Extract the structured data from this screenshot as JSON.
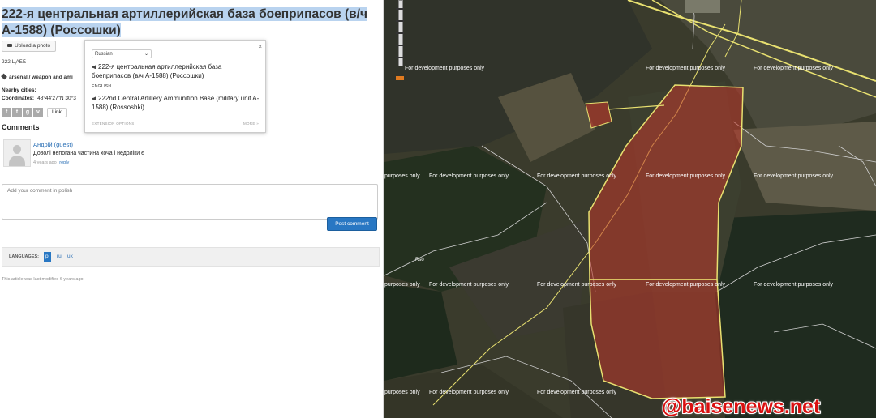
{
  "article": {
    "title": "222-я центральная артиллерийская база боеприпасов (в/ч А-1588) (Россошки)",
    "upload_label": "Upload a photo",
    "abbreviation": "222 ЦАББ",
    "tags": "arsenal / weapon and ami",
    "nearby_label": "Nearby cities:",
    "coordinates_label": "Coordinates:",
    "coordinates_value": "48°44'27\"N 30°3",
    "link_label": "Link"
  },
  "comments": {
    "heading": "Comments",
    "items": [
      {
        "author": "Андрій (guest)",
        "text": "Доволі непогана частина хоча і недоліки є",
        "time": "4 years ago",
        "reply": "reply"
      }
    ],
    "input_placeholder": "Add your comment in polish",
    "post_label": "Post comment"
  },
  "languages": {
    "label": "LANGUAGES:",
    "items": [
      "pl",
      "ru",
      "uk"
    ],
    "active": "pl"
  },
  "footer": {
    "modified": "This article was last modified 6 years ago"
  },
  "translate_popup": {
    "language_selected": "Russian",
    "close_glyph": "×",
    "source_text": "222-я центральная артиллерийская база боеприпасов (в/ч А-1588) (Россошки)",
    "target_language": "ENGLISH",
    "translation": "222nd Central Artillery Ammunition Base (military unit A-1588) (Rossoshki)",
    "extension_options": "EXTENSION OPTIONS",
    "more": "MORE »"
  },
  "map": {
    "watermark": "For development purposes only",
    "partial_watermark": "purposes only",
    "place_label": "Rso",
    "brand": "@baisenews.net",
    "colors": {
      "highlight": "#c0392b",
      "road": "#f0e68c",
      "brand": "#d91010"
    }
  },
  "icons": {
    "camera": "camera-icon",
    "tag": "tag-icon",
    "speaker": "speaker-icon",
    "close": "close-icon"
  }
}
